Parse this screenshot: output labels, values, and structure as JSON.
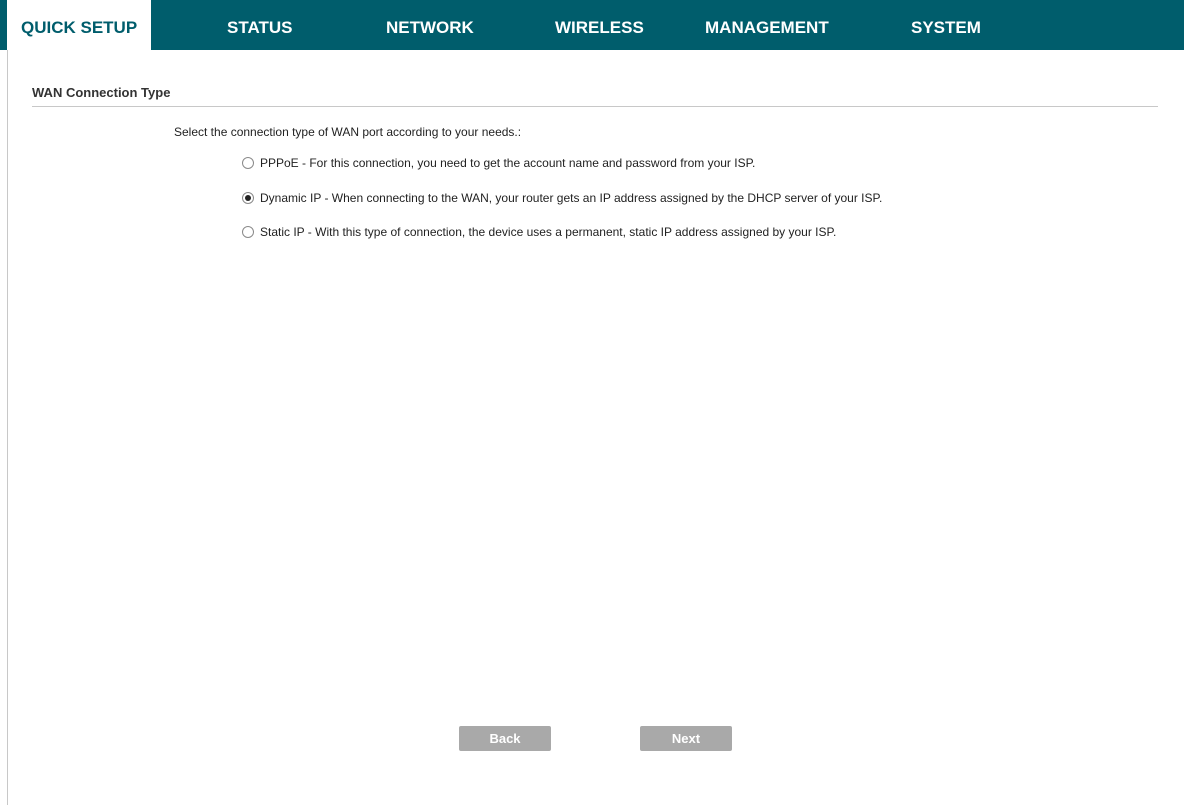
{
  "nav": {
    "tabs": [
      {
        "label": "QUICK SETUP",
        "active": true
      },
      {
        "label": "STATUS",
        "active": false
      },
      {
        "label": "NETWORK",
        "active": false
      },
      {
        "label": "WIRELESS",
        "active": false
      },
      {
        "label": "MANAGEMENT",
        "active": false
      },
      {
        "label": "SYSTEM",
        "active": false
      }
    ]
  },
  "section": {
    "title": "WAN Connection Type"
  },
  "form": {
    "prompt": "Select the connection type of WAN port according to your needs.:",
    "options": [
      {
        "label": "PPPoE - For this connection, you need to get the account name and password from your ISP.",
        "checked": false
      },
      {
        "label": "Dynamic IP - When connecting to the WAN, your router gets an IP address assigned by the DHCP server of your ISP.",
        "checked": true
      },
      {
        "label": "Static IP - With this type of connection, the device uses a permanent, static IP address assigned by your ISP.",
        "checked": false
      }
    ]
  },
  "buttons": {
    "back_label": "Back",
    "next_label": "Next"
  },
  "colors": {
    "nav_bg": "#005d6c",
    "button_bg": "#a9a9a9"
  }
}
